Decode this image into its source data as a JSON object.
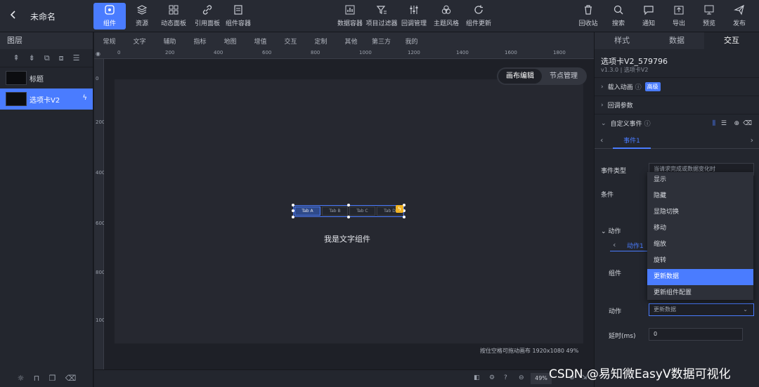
{
  "app": {
    "title": "未命名"
  },
  "toolbar_left": [
    {
      "label": "组件",
      "icon": "component-icon"
    },
    {
      "label": "资源",
      "icon": "layers-icon"
    },
    {
      "label": "动态面板",
      "icon": "panel-icon"
    },
    {
      "label": "引用面板",
      "icon": "link-icon"
    },
    {
      "label": "组件容器",
      "icon": "container-icon"
    }
  ],
  "toolbar_mid": [
    {
      "label": "数据容器",
      "icon": "chart-icon"
    },
    {
      "label": "项目过滤器",
      "icon": "filter-icon"
    },
    {
      "label": "回调管理",
      "icon": "sliders-icon"
    },
    {
      "label": "主题风格",
      "icon": "theme-icon"
    },
    {
      "label": "组件更新",
      "icon": "refresh-icon"
    }
  ],
  "toolbar_right": [
    {
      "label": "回收站",
      "icon": "trash-icon"
    },
    {
      "label": "搜索",
      "icon": "search-icon"
    },
    {
      "label": "通知",
      "icon": "message-icon"
    },
    {
      "label": "导出",
      "icon": "export-icon"
    },
    {
      "label": "预览",
      "icon": "preview-icon"
    },
    {
      "label": "发布",
      "icon": "send-icon"
    }
  ],
  "layers": {
    "header": "图层",
    "items": [
      {
        "name": "标题",
        "selected": false
      },
      {
        "name": "选项卡V2",
        "selected": true
      }
    ]
  },
  "category_tabs": [
    "常规",
    "文字",
    "辅助",
    "指标",
    "地图",
    "增值",
    "交互",
    "定制",
    "其他",
    "第三方",
    "我的"
  ],
  "ruler": {
    "h": [
      "0",
      "200",
      "400",
      "600",
      "800",
      "1000",
      "1200",
      "1400",
      "1600",
      "1800"
    ],
    "v": [
      "0",
      "200",
      "400",
      "600",
      "800",
      "1000"
    ]
  },
  "canvas": {
    "mode_tabs": [
      {
        "label": "画布编辑",
        "active": true
      },
      {
        "label": "节点管理",
        "active": false
      }
    ],
    "tabs": [
      {
        "label": "Tab A",
        "active": true
      },
      {
        "label": "Tab B"
      },
      {
        "label": "Tab C"
      },
      {
        "label": "Tab D"
      }
    ],
    "text_component": "我是文字组件",
    "hint": "按住空格可拖动画布   1920x1080 49%",
    "zoom": "49%"
  },
  "right_panel": {
    "tabs": [
      {
        "label": "样式"
      },
      {
        "label": "数据"
      },
      {
        "label": "交互",
        "active": true
      }
    ],
    "component_name": "选项卡V2_579796",
    "component_version": "v1.3.0 | 选项卡V2",
    "sections": {
      "load_anim": "载入动画",
      "load_anim_badge": "高级",
      "callback": "回调参数",
      "custom_event": "自定义事件"
    },
    "event_tab": "事件1",
    "event_type_label": "事件类型",
    "event_type_value": "当请求完成或数据变化时",
    "condition_label": "条件",
    "action_section": "动作",
    "action_tab": "动作1",
    "component_label": "组件",
    "action_label": "动作",
    "action_value": "更新数据",
    "delay_label": "延时(ms)",
    "delay_value": "0",
    "dropdown": [
      "显示",
      "隐藏",
      "显隐切换",
      "移动",
      "缩放",
      "旋转",
      "更新数据",
      "更新组件配置"
    ],
    "dropdown_selected": 6
  },
  "watermark": "CSDN @易知微EasyV数据可视化"
}
